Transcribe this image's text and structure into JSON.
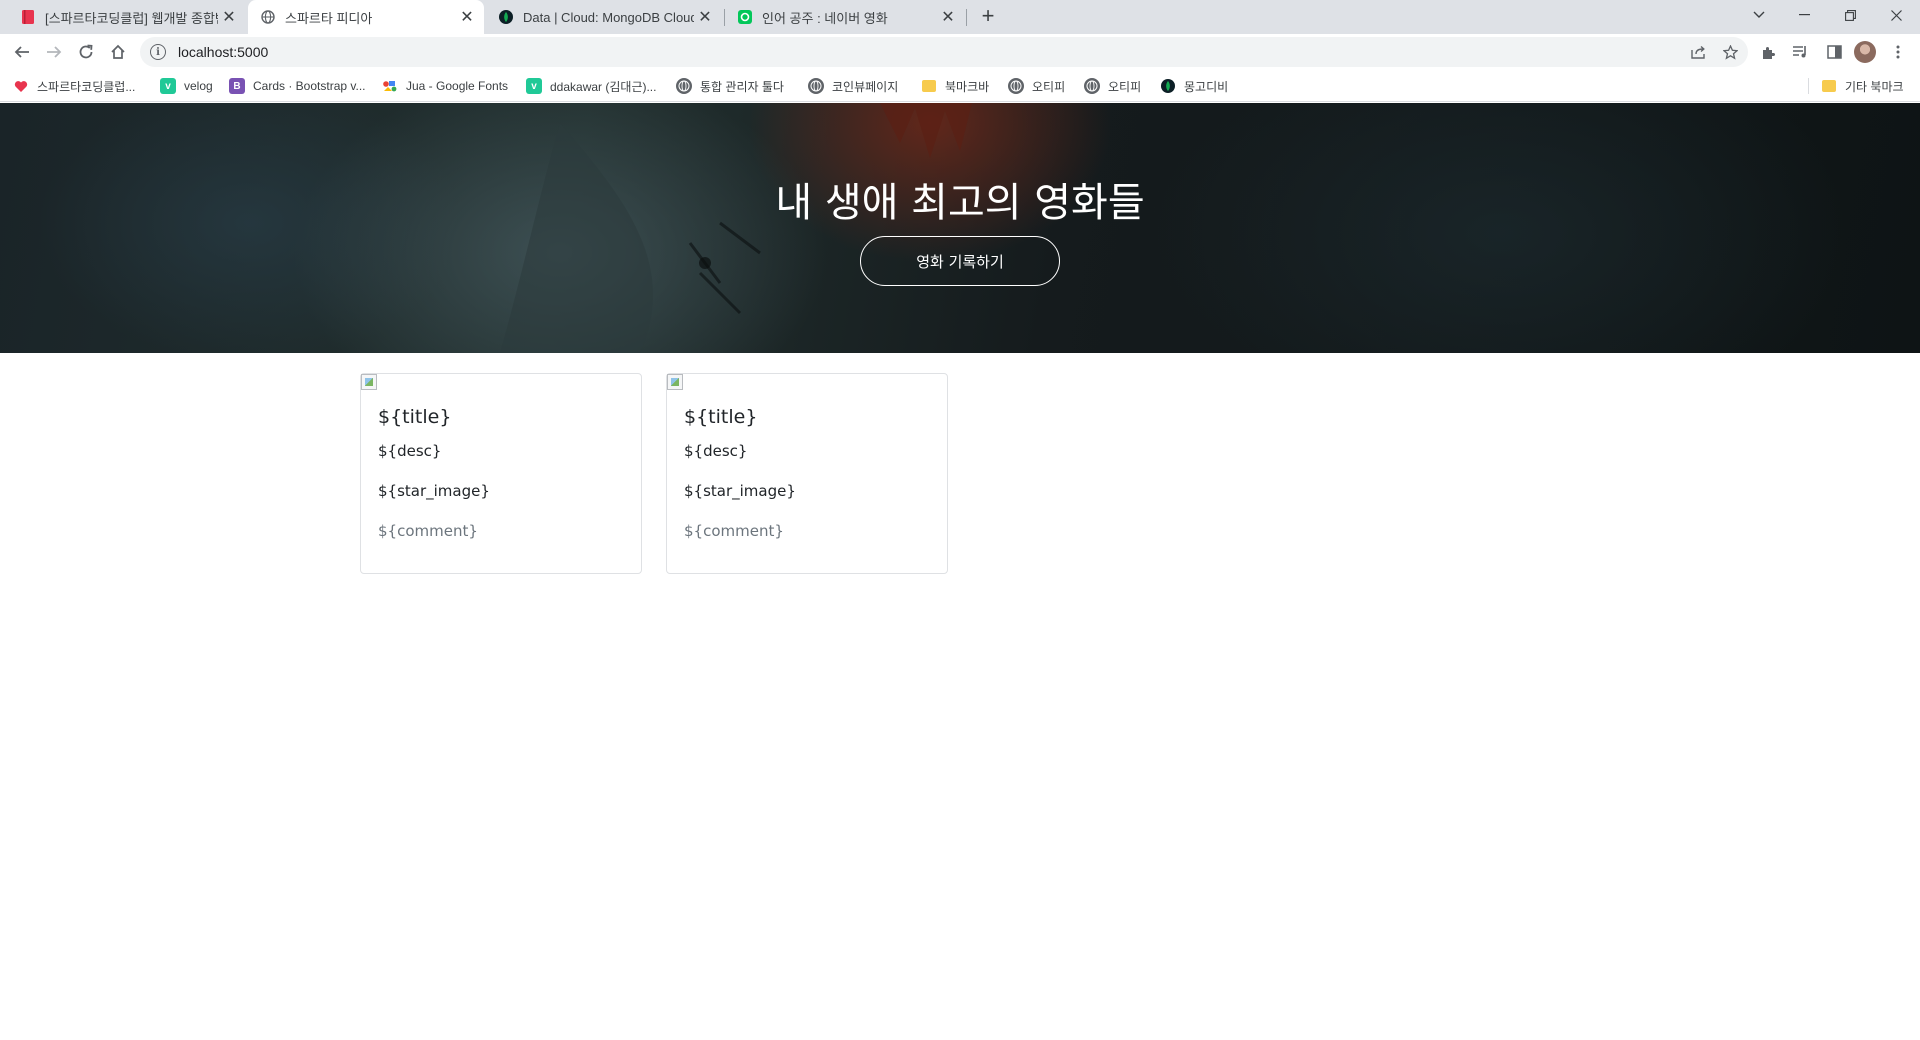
{
  "browser": {
    "tabs": [
      {
        "title": "[스파르타코딩클럽] 웹개발 종합반",
        "favicon": "sparta-book-icon",
        "active": false
      },
      {
        "title": "스파르타 피디아",
        "favicon": "globe-icon",
        "active": true
      },
      {
        "title": "Data | Cloud: MongoDB Cloud",
        "favicon": "mongodb-leaf-icon",
        "active": false
      },
      {
        "title": "인어 공주 : 네이버 영화",
        "favicon": "naver-movie-icon",
        "active": false
      }
    ],
    "new_tab_label": "+",
    "url": "localhost:5000",
    "bookmarks": [
      {
        "label": "스파르타코딩클럽...",
        "icon": "sparta-heart-icon"
      },
      {
        "label": "velog",
        "icon": "velog-icon"
      },
      {
        "label": "Cards · Bootstrap v...",
        "icon": "bootstrap-icon"
      },
      {
        "label": "Jua - Google Fonts",
        "icon": "google-fonts-icon"
      },
      {
        "label": "ddakawar (김대근)...",
        "icon": "velog-icon"
      },
      {
        "label": "통합 관리자 툴다",
        "icon": "globe-icon"
      },
      {
        "label": "코인뷰페이지",
        "icon": "globe-icon"
      },
      {
        "label": "북마크바",
        "icon": "folder-icon"
      },
      {
        "label": "오티피",
        "icon": "globe-icon"
      },
      {
        "label": "오티피",
        "icon": "globe-icon"
      },
      {
        "label": "몽고디비",
        "icon": "mongodb-leaf-icon"
      }
    ],
    "other_bookmarks": "기타 북마크",
    "colors": {
      "tabstrip": "#dee1e6",
      "velog": "#20c997",
      "bootstrap": "#7952b3",
      "mongodb": "#13aa52",
      "naver": "#03c75a"
    }
  },
  "hero": {
    "title": "내 생애 최고의 영화들",
    "button_label": "영화 기록하기"
  },
  "cards": [
    {
      "title": "${title}",
      "desc": "${desc}",
      "star": "${star_image}",
      "comment": "${comment}"
    },
    {
      "title": "${title}",
      "desc": "${desc}",
      "star": "${star_image}",
      "comment": "${comment}"
    }
  ]
}
